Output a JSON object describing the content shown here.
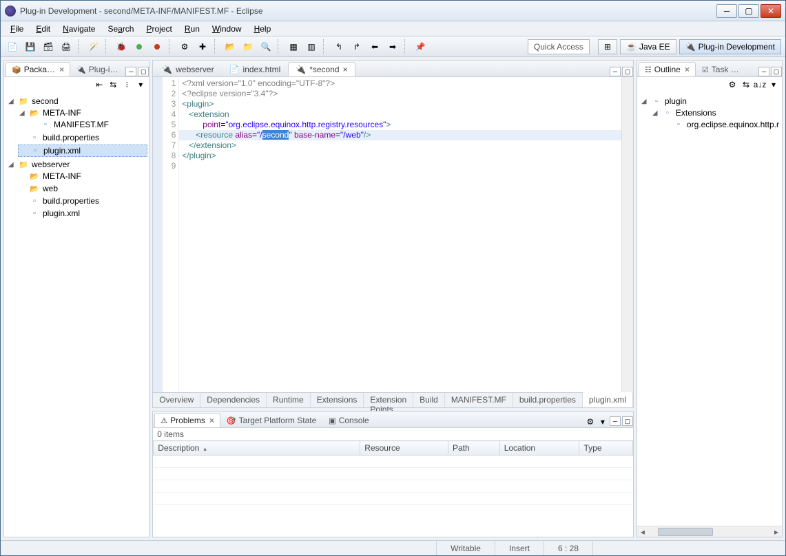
{
  "window": {
    "title": "Plug-in Development - second/META-INF/MANIFEST.MF - Eclipse"
  },
  "menu": [
    "File",
    "Edit",
    "Navigate",
    "Search",
    "Project",
    "Run",
    "Window",
    "Help"
  ],
  "quick_access": "Quick Access",
  "perspectives": [
    {
      "label": "Java EE",
      "active": false
    },
    {
      "label": "Plug-in Development",
      "active": true
    }
  ],
  "left": {
    "tabs": [
      {
        "label": "Packa…",
        "active": true
      },
      {
        "label": "Plug-i…",
        "active": false
      }
    ],
    "tree": [
      {
        "label": "second",
        "expanded": true,
        "icon": "project",
        "children": [
          {
            "label": "META-INF",
            "expanded": true,
            "icon": "folder",
            "children": [
              {
                "label": "MANIFEST.MF",
                "icon": "file"
              }
            ]
          },
          {
            "label": "build.properties",
            "icon": "file"
          },
          {
            "label": "plugin.xml",
            "icon": "file",
            "selected": true
          }
        ]
      },
      {
        "label": "webserver",
        "expanded": true,
        "icon": "project",
        "children": [
          {
            "label": "META-INF",
            "expanded": false,
            "icon": "folder"
          },
          {
            "label": "web",
            "expanded": false,
            "icon": "folder"
          },
          {
            "label": "build.properties",
            "icon": "file"
          },
          {
            "label": "plugin.xml",
            "icon": "file"
          }
        ]
      }
    ]
  },
  "editor": {
    "tabs": [
      {
        "label": "webserver",
        "active": false,
        "dirty": false
      },
      {
        "label": "index.html",
        "active": false,
        "dirty": false
      },
      {
        "label": "*second",
        "active": true,
        "dirty": true
      }
    ],
    "code": {
      "lines": [
        {
          "n": 1,
          "html": "<span class='pi'>&lt;?xml version=\"1.0\" encoding=\"UTF-8\"?&gt;</span>"
        },
        {
          "n": 2,
          "html": "<span class='pi'>&lt;?eclipse version=\"3.4\"?&gt;</span>"
        },
        {
          "n": 3,
          "html": "<span class='tag'>&lt;plugin&gt;</span>"
        },
        {
          "n": 4,
          "html": "   <span class='tag'>&lt;extension</span>"
        },
        {
          "n": 5,
          "html": "         <span class='attr'>point</span>=<span class='str'>\"org.eclipse.equinox.http.registry.resources\"</span><span class='tag'>&gt;</span>"
        },
        {
          "n": 6,
          "hl": true,
          "html": "      <span class='tag'>&lt;resource</span> <span class='attr'>alias</span>=<span class='str'>\"/</span><span class='sel-hl'>second</span><span class='str'>\"</span> <span class='attr'>base-name</span>=<span class='str'>\"/web\"</span><span class='tag'>/&gt;</span>"
        },
        {
          "n": 7,
          "html": "   <span class='tag'>&lt;/extension&gt;</span>"
        },
        {
          "n": 8,
          "html": "<span class='tag'>&lt;/plugin&gt;</span>"
        },
        {
          "n": 9,
          "html": ""
        }
      ]
    },
    "bottom_tabs": [
      "Overview",
      "Dependencies",
      "Runtime",
      "Extensions",
      "Extension Points",
      "Build",
      "MANIFEST.MF",
      "build.properties",
      "plugin.xml"
    ],
    "bottom_tab_active": "plugin.xml"
  },
  "outline": {
    "tabs": [
      {
        "label": "Outline",
        "active": true
      },
      {
        "label": "Task …",
        "active": false
      }
    ],
    "tree": [
      {
        "label": "plugin",
        "expanded": true,
        "children": [
          {
            "label": "Extensions",
            "expanded": true,
            "children": [
              {
                "label": "org.eclipse.equinox.http.r"
              }
            ]
          }
        ]
      }
    ]
  },
  "problems": {
    "tabs": [
      {
        "label": "Problems",
        "active": true
      },
      {
        "label": "Target Platform State",
        "active": false
      },
      {
        "label": "Console",
        "active": false
      }
    ],
    "count": "0 items",
    "columns": [
      "Description",
      "Resource",
      "Path",
      "Location",
      "Type"
    ]
  },
  "status": {
    "writable": "Writable",
    "insert": "Insert",
    "pos": "6 : 28"
  }
}
